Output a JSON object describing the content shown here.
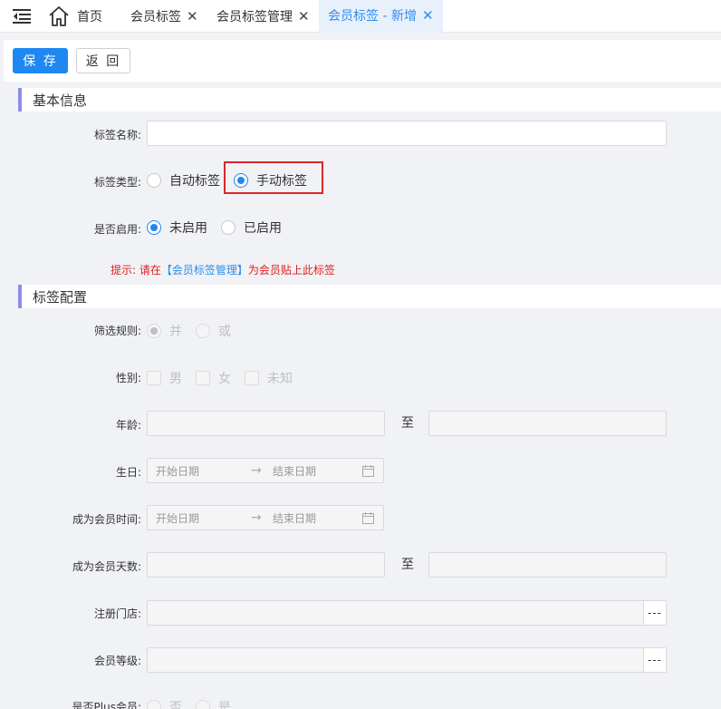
{
  "tabs": {
    "home_label": "首页",
    "items": [
      {
        "label": "会员标签"
      },
      {
        "label": "会员标签管理"
      },
      {
        "label": "会员标签 - 新增"
      }
    ]
  },
  "toolbar": {
    "save_label": "保 存",
    "back_label": "返 回"
  },
  "basic": {
    "title": "基本信息",
    "name_label": "标签名称:",
    "name_value": "",
    "type_label": "标签类型:",
    "type_options": [
      "自动标签",
      "手动标签"
    ],
    "type_selected": "手动标签",
    "enabled_label": "是否启用:",
    "enabled_options": [
      "未启用",
      "已启用"
    ],
    "enabled_selected": "未启用",
    "hint_prefix": "提示:  请在",
    "hint_link": "【会员标签管理】",
    "hint_suffix": "为会员贴上此标签"
  },
  "config": {
    "title": "标签配置",
    "rule_label": "筛选规则:",
    "rule_options": [
      "并",
      "或"
    ],
    "gender_label": "性别:",
    "gender_options": [
      "男",
      "女",
      "未知"
    ],
    "age_label": "年龄:",
    "range_to": "至",
    "birthday_label": "生日:",
    "member_since_label": "成为会员时间:",
    "member_days_label": "成为会员天数:",
    "date_start_placeholder": "开始日期",
    "date_end_placeholder": "结束日期",
    "store_label": "注册门店:",
    "level_label": "会员等级:",
    "plus_label": "是否Plus会员:",
    "plus_options": [
      "否",
      "是"
    ],
    "lookup_symbol": "---"
  },
  "colors": {
    "accent": "#1e88f0",
    "highlight": "#d9262b",
    "section_bar": "#8a8fe6"
  }
}
